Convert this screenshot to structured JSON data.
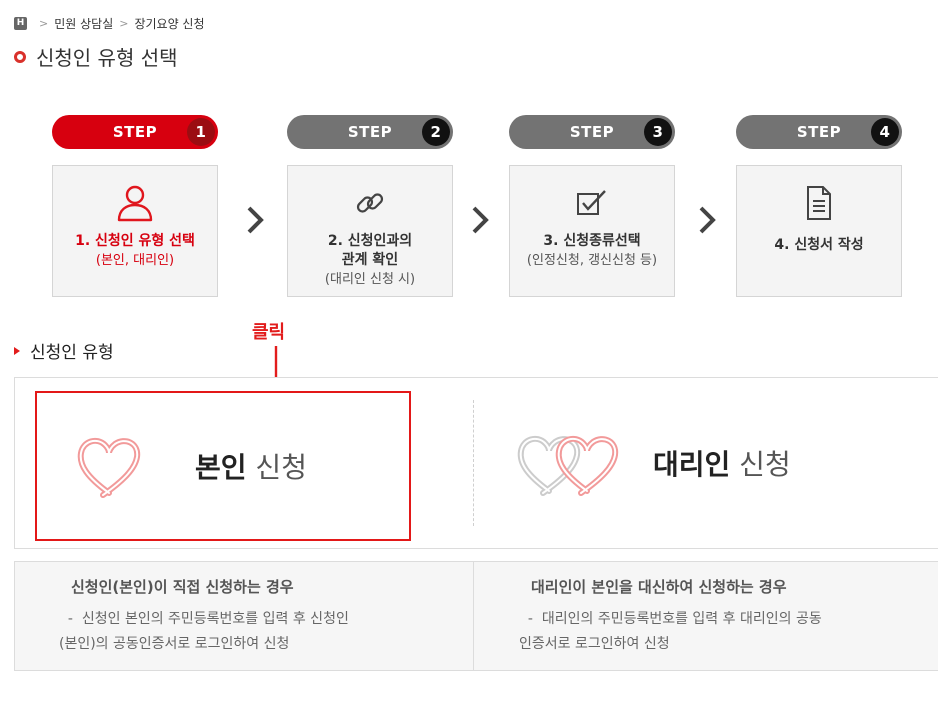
{
  "breadcrumb": {
    "home": "H",
    "items": [
      "민원 상담실",
      "장기요양 신청"
    ]
  },
  "page_title": "신청인 유형 선택",
  "steps": [
    {
      "pill": "STEP",
      "num": "1",
      "label": "1. 신청인 유형 선택",
      "sub": "(본인, 대리인)",
      "icon": "person-icon",
      "active": true
    },
    {
      "pill": "STEP",
      "num": "2",
      "label_line1": "2. 신청인과의",
      "label_line2": "관계 확인",
      "sub": "(대리인 신청 시)",
      "icon": "link-icon"
    },
    {
      "pill": "STEP",
      "num": "3",
      "label": "3. 신청종류선택",
      "sub": "(인정신청, 갱신신청 등)",
      "icon": "checkbox-icon"
    },
    {
      "pill": "STEP",
      "num": "4",
      "label": "4. 신청서 작성",
      "icon": "document-icon"
    }
  ],
  "click_annotation": "클릭",
  "section_title": "신청인 유형",
  "choices": {
    "self": {
      "bold": "본인",
      "rest": " 신청"
    },
    "proxy": {
      "bold": "대리인",
      "rest": " 신청"
    }
  },
  "descriptions": {
    "self": {
      "title": "신청인(본인)이 직접 신청하는 경우",
      "body_line1": "  -  신청인 본인의 주민등록번호를 입력 후 신청인",
      "body_line2": "(본인)의 공동인증서로 로그인하여 신청"
    },
    "proxy": {
      "title": "대리인이 본인을 대신하여 신청하는 경우",
      "body_line1": "  -  대리인의 주민등록번호를 입력 후 대리인의 공동",
      "body_line2": "인증서로 로그인하여 신청"
    }
  },
  "colors": {
    "accent": "#d7000f",
    "step_inactive": "#737373",
    "highlight": "#e31818"
  }
}
